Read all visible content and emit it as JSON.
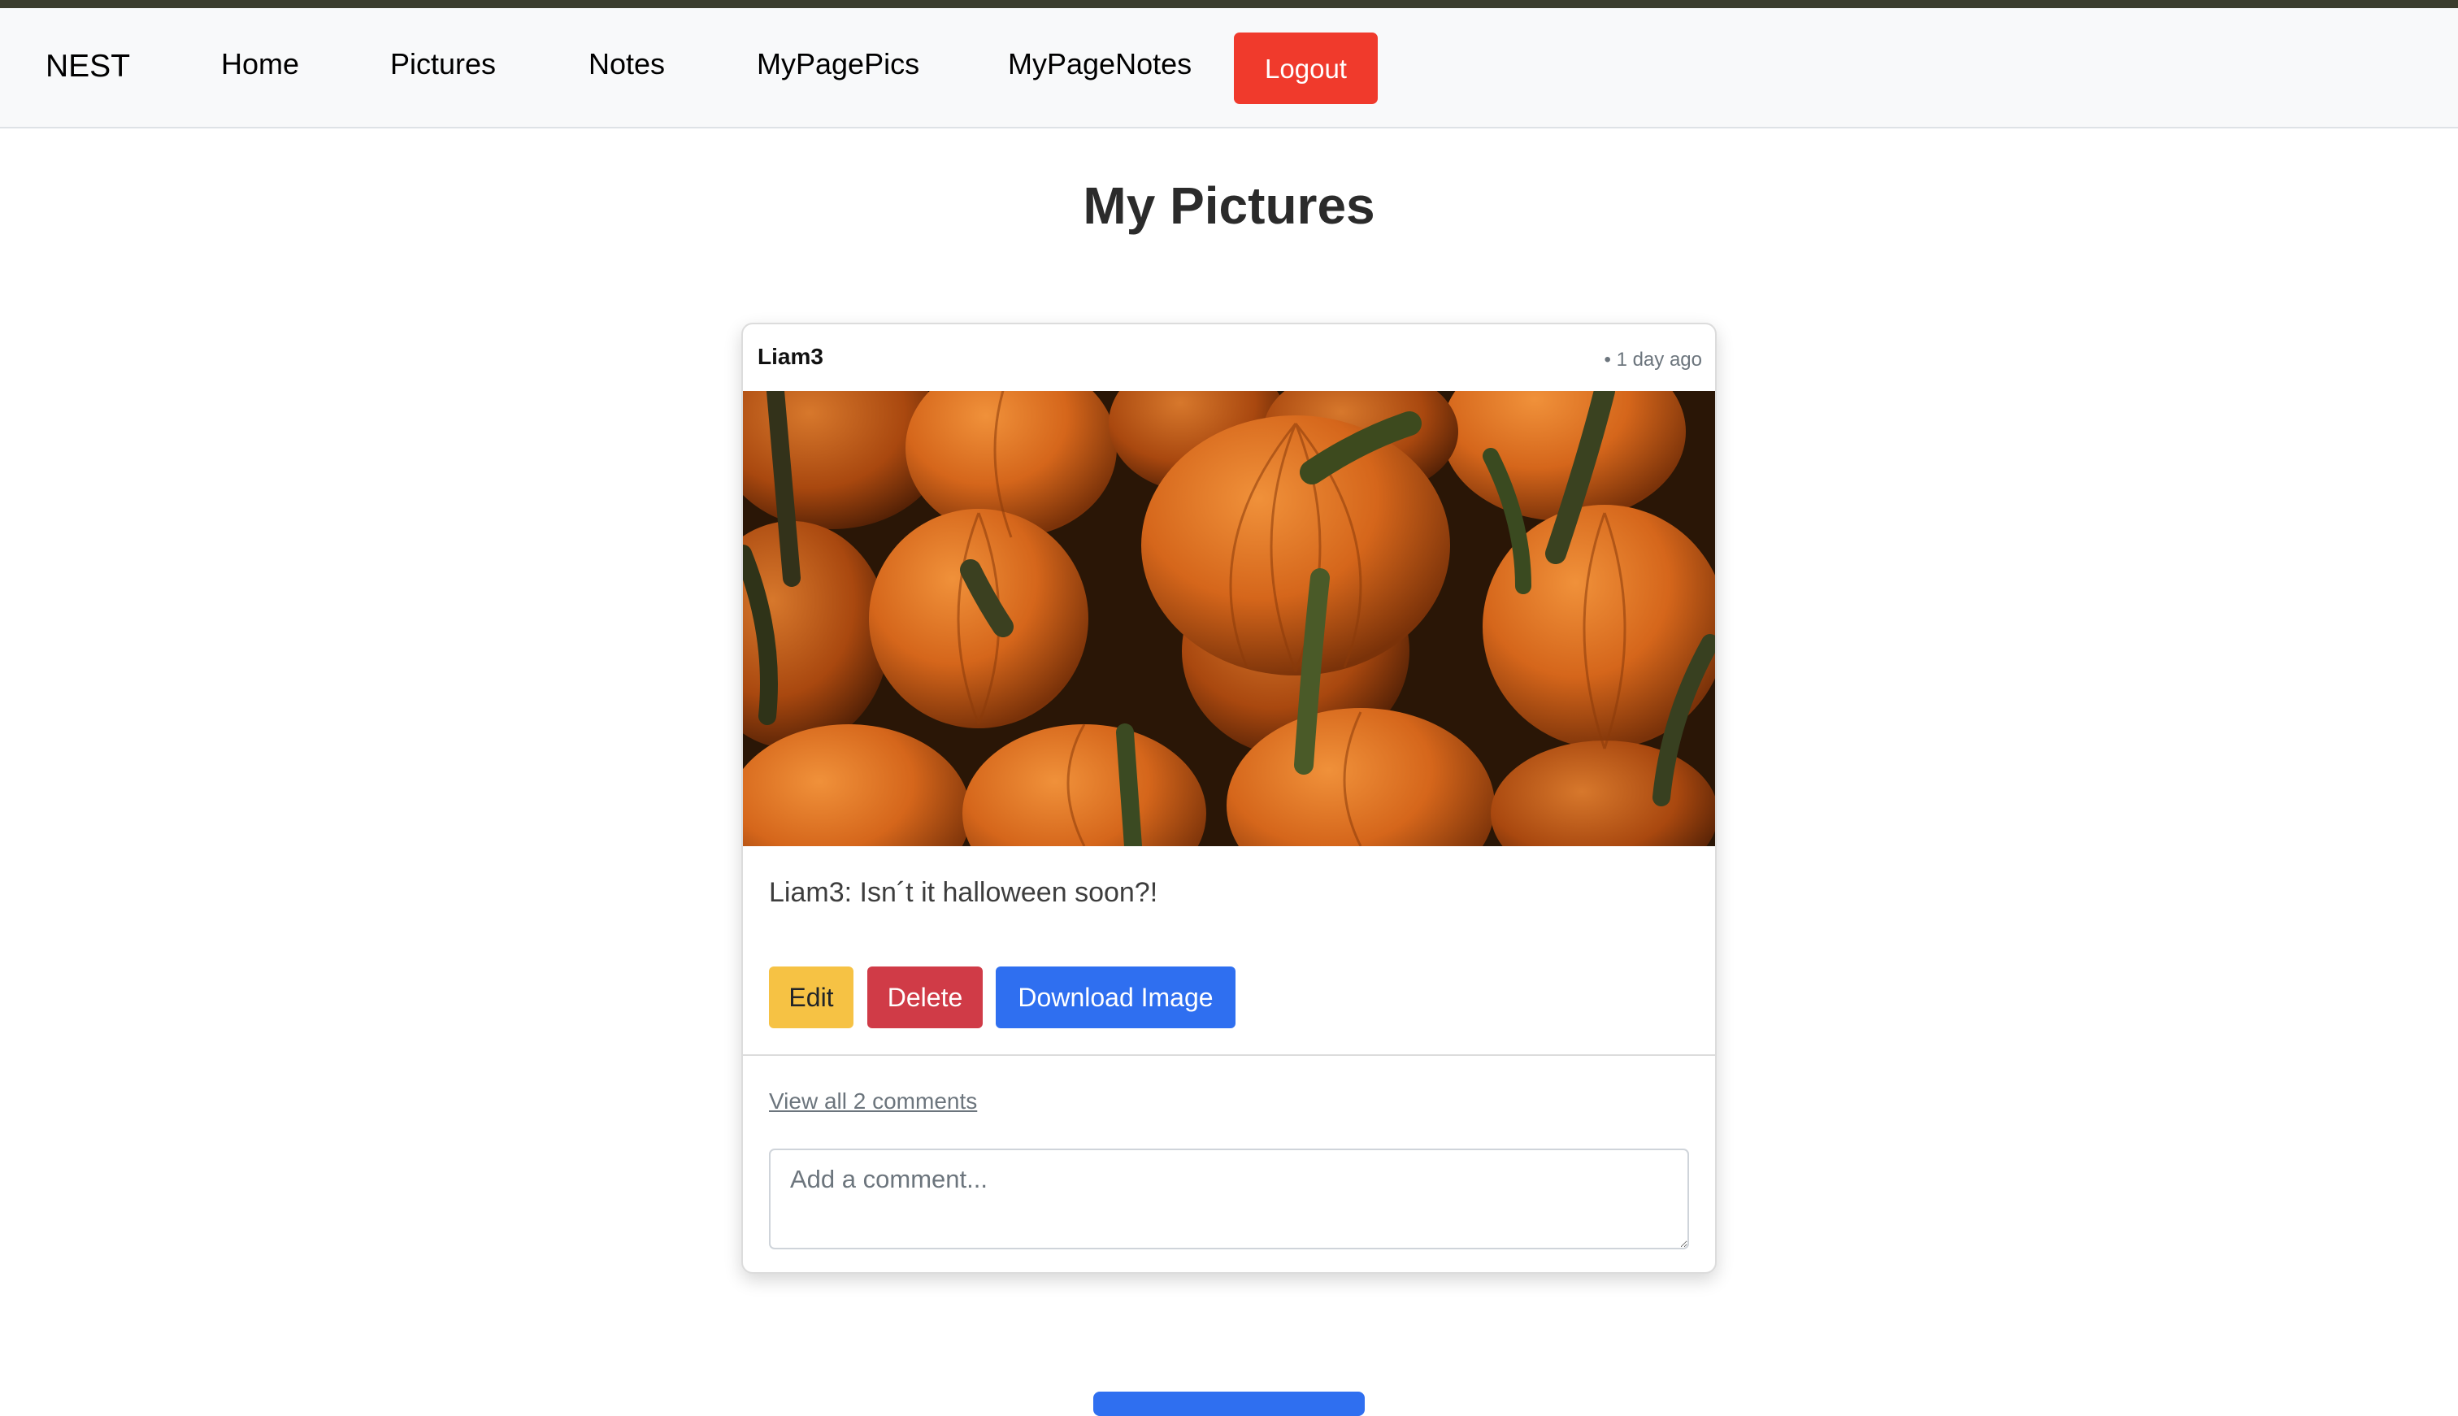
{
  "navbar": {
    "brand": "NEST",
    "links": [
      "Home",
      "Pictures",
      "Notes",
      "MyPagePics",
      "MyPageNotes"
    ],
    "logout_label": "Logout"
  },
  "page": {
    "title": "My Pictures"
  },
  "post": {
    "username": "Liam3",
    "timestamp": "• 1 day ago",
    "image_subject": "pile of orange pumpkins",
    "caption": "Liam3: Isn´t it halloween soon?!",
    "actions": {
      "edit_label": "Edit",
      "delete_label": "Delete",
      "download_label": "Download Image"
    },
    "comments_link": "View all 2 comments",
    "comment_placeholder": "Add a comment..."
  },
  "colors": {
    "logout": "#f03a2c",
    "edit": "#f6c244",
    "delete": "#d03b47",
    "primary": "#2f6ff0"
  }
}
